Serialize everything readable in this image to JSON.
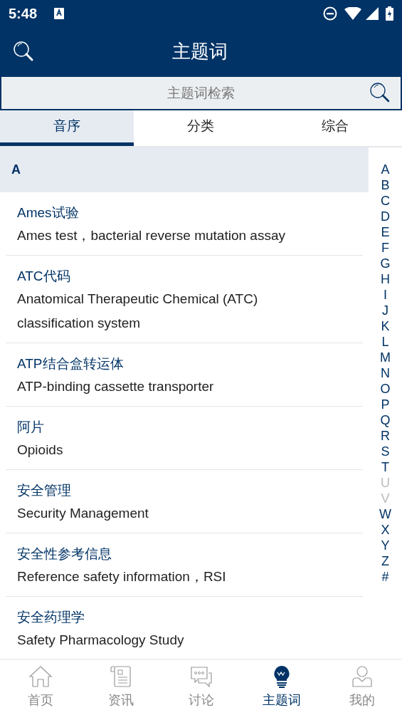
{
  "status_bar": {
    "time": "5:48"
  },
  "header": {
    "title": "主题词"
  },
  "search": {
    "placeholder": "主题词检索"
  },
  "tabs": [
    {
      "label": "音序",
      "selected": true
    },
    {
      "label": "分类",
      "selected": false
    },
    {
      "label": "综合",
      "selected": false
    }
  ],
  "section": {
    "letter": "A"
  },
  "entries": [
    {
      "term": "Ames试验",
      "translation": "Ames test，bacterial reverse mutation assay"
    },
    {
      "term": "ATC代码",
      "translation": "Anatomical Therapeutic Chemical (ATC) classification system"
    },
    {
      "term": "ATP结合盒转运体",
      "translation": "ATP-binding cassette transporter"
    },
    {
      "term": "阿片",
      "translation": "Opioids"
    },
    {
      "term": "安全管理",
      "translation": "Security Management"
    },
    {
      "term": "安全性参考信息",
      "translation": "Reference safety information，RSI"
    },
    {
      "term": "安全药理学",
      "translation": "Safety Pharmacology Study"
    }
  ],
  "index": [
    {
      "letter": "A",
      "disabled": false
    },
    {
      "letter": "B",
      "disabled": false
    },
    {
      "letter": "C",
      "disabled": false
    },
    {
      "letter": "D",
      "disabled": false
    },
    {
      "letter": "E",
      "disabled": false
    },
    {
      "letter": "F",
      "disabled": false
    },
    {
      "letter": "G",
      "disabled": false
    },
    {
      "letter": "H",
      "disabled": false
    },
    {
      "letter": "I",
      "disabled": false
    },
    {
      "letter": "J",
      "disabled": false
    },
    {
      "letter": "K",
      "disabled": false
    },
    {
      "letter": "L",
      "disabled": false
    },
    {
      "letter": "M",
      "disabled": false
    },
    {
      "letter": "N",
      "disabled": false
    },
    {
      "letter": "O",
      "disabled": false
    },
    {
      "letter": "P",
      "disabled": false
    },
    {
      "letter": "Q",
      "disabled": false
    },
    {
      "letter": "R",
      "disabled": false
    },
    {
      "letter": "S",
      "disabled": false
    },
    {
      "letter": "T",
      "disabled": false
    },
    {
      "letter": "U",
      "disabled": true
    },
    {
      "letter": "V",
      "disabled": true
    },
    {
      "letter": "W",
      "disabled": false
    },
    {
      "letter": "X",
      "disabled": false
    },
    {
      "letter": "Y",
      "disabled": false
    },
    {
      "letter": "Z",
      "disabled": false
    },
    {
      "letter": "#",
      "disabled": false
    }
  ],
  "bottom_nav": [
    {
      "label": "首页",
      "kind": "home",
      "selected": false
    },
    {
      "label": "资讯",
      "kind": "news",
      "selected": false
    },
    {
      "label": "讨论",
      "kind": "chat",
      "selected": false
    },
    {
      "label": "主题词",
      "kind": "bulb",
      "selected": true
    },
    {
      "label": "我的",
      "kind": "user",
      "selected": false
    }
  ]
}
